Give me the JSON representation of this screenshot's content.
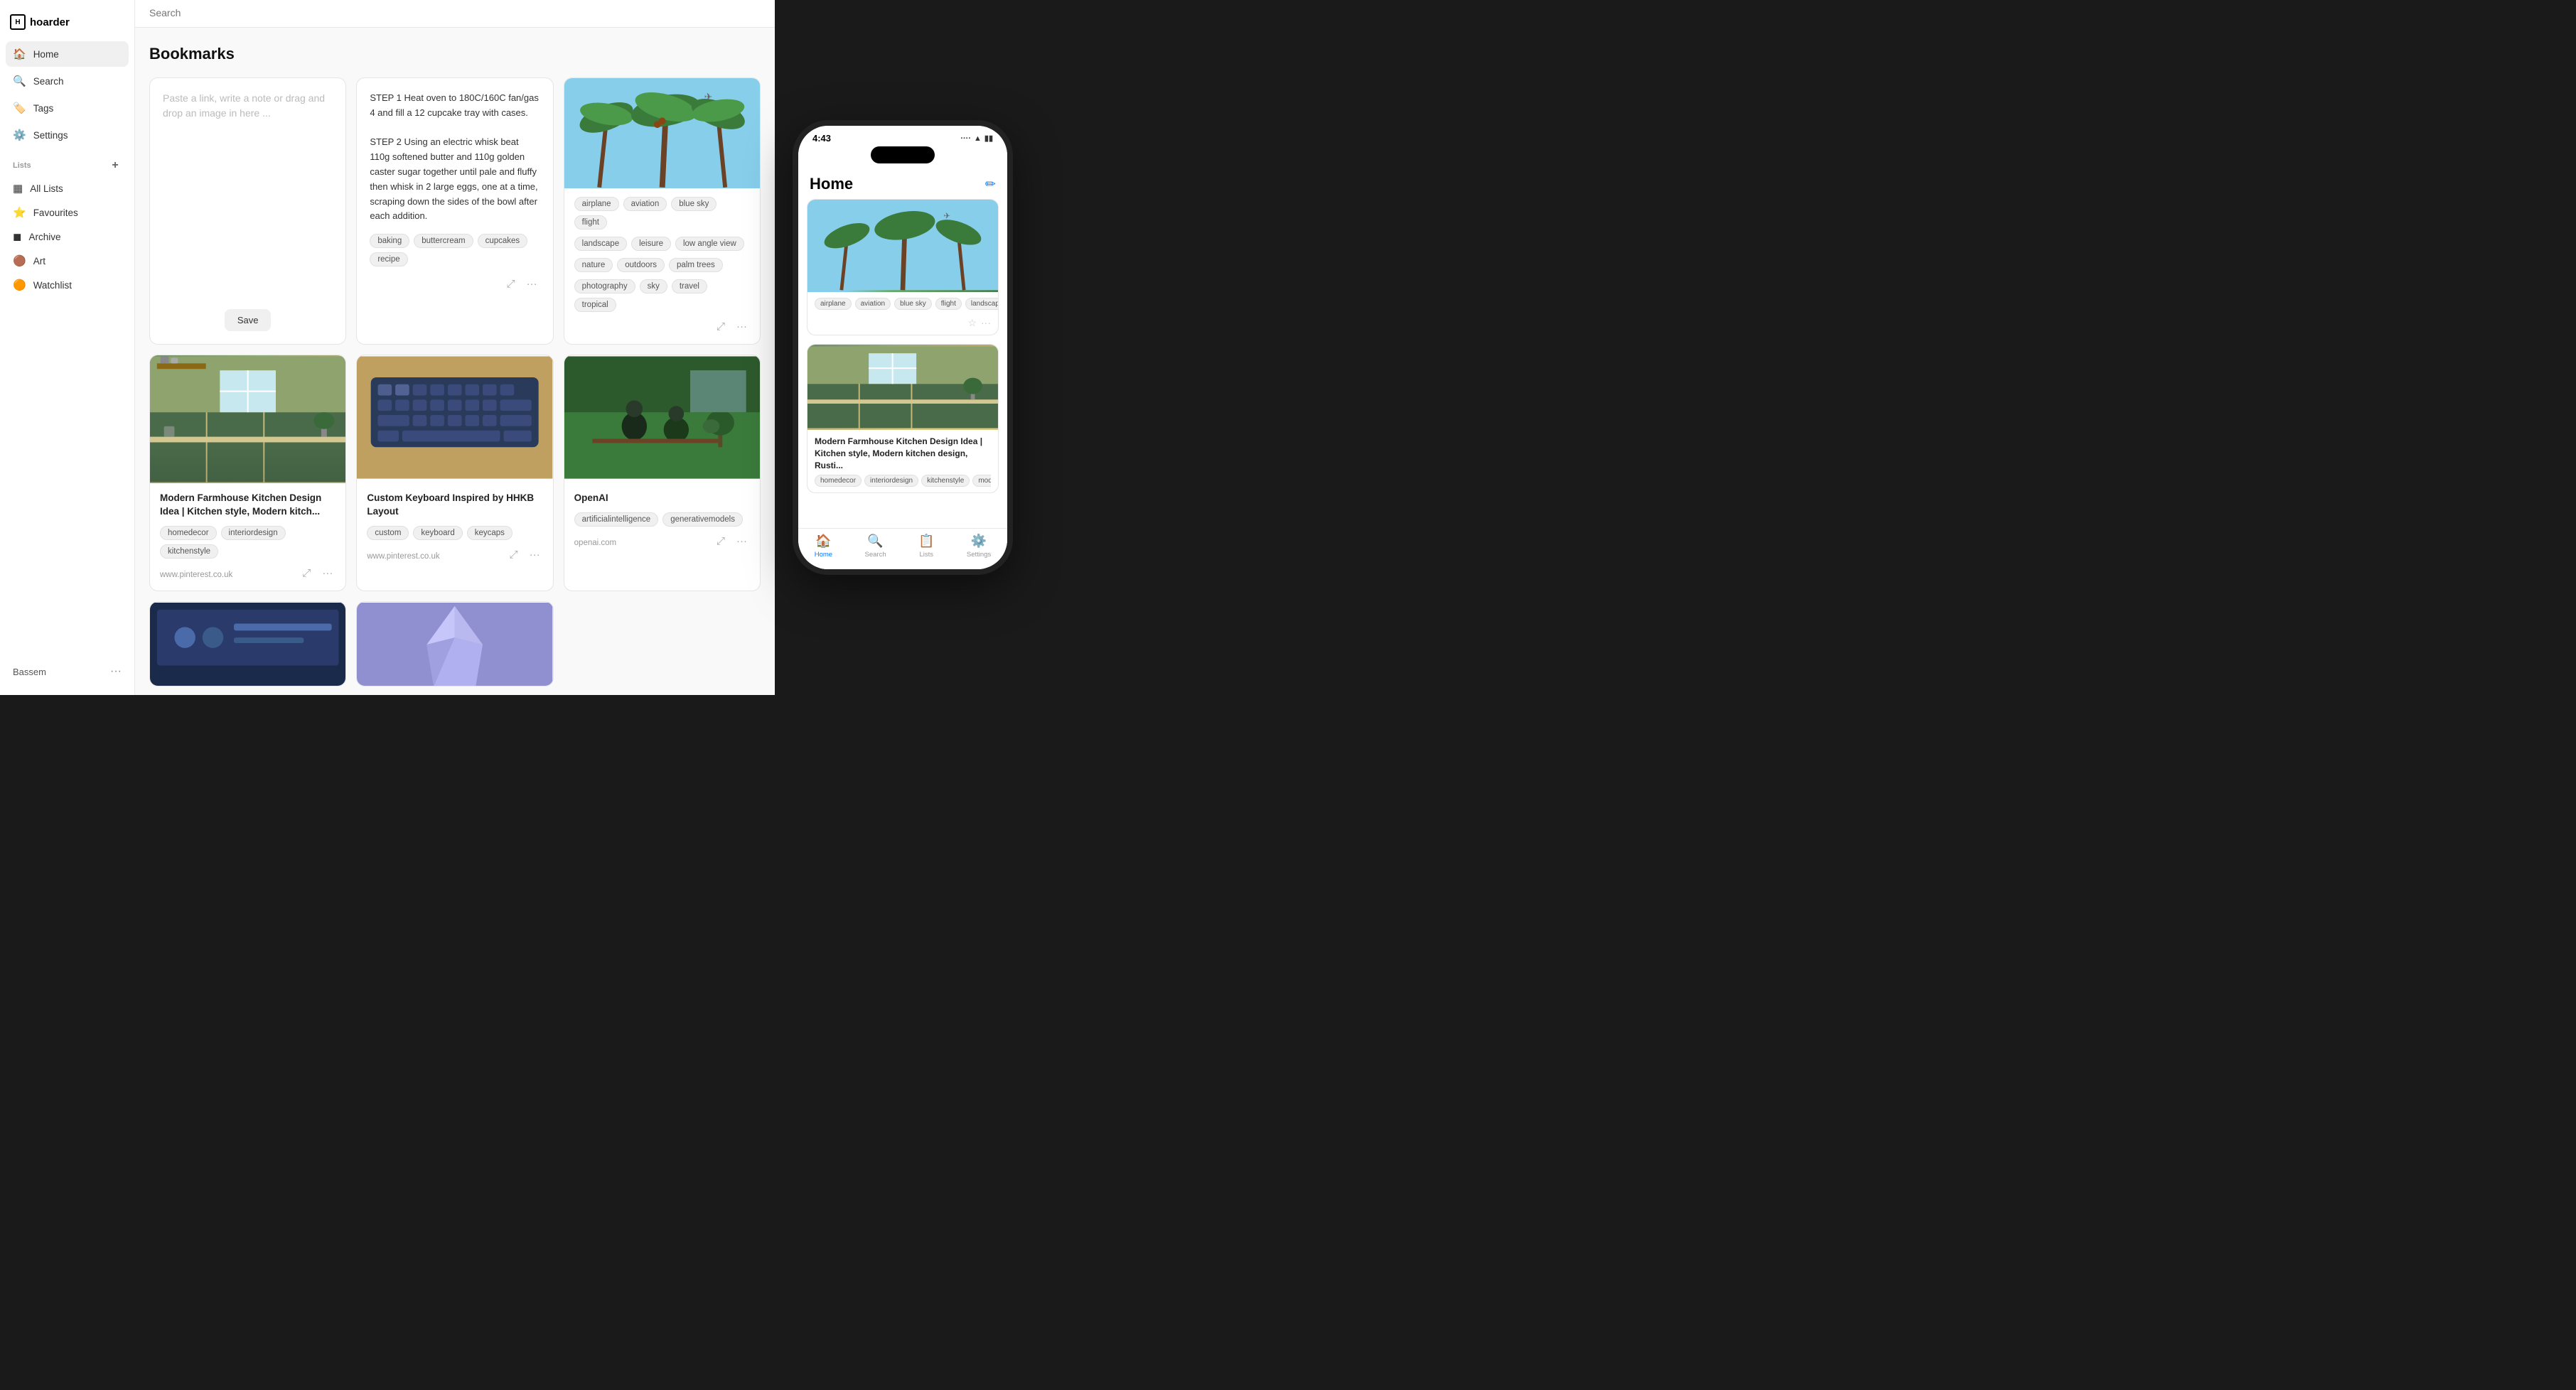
{
  "app": {
    "logo_icon": "H",
    "logo_text": "hoarder"
  },
  "sidebar": {
    "nav_items": [
      {
        "id": "home",
        "label": "Home",
        "icon": "🏠",
        "active": true
      },
      {
        "id": "search",
        "label": "Search",
        "icon": "🔍",
        "active": false
      },
      {
        "id": "tags",
        "label": "Tags",
        "icon": "🏷️",
        "active": false
      },
      {
        "id": "settings",
        "label": "Settings",
        "icon": "⚙️",
        "active": false
      }
    ],
    "lists_title": "Lists",
    "list_items": [
      {
        "id": "all-lists",
        "label": "All Lists",
        "icon": "▦"
      },
      {
        "id": "favourites",
        "label": "Favourites",
        "icon": "⭐"
      },
      {
        "id": "archive",
        "label": "Archive",
        "icon": "◼"
      },
      {
        "id": "art",
        "label": "Art",
        "icon": "🟤"
      },
      {
        "id": "watchlist",
        "label": "Watchlist",
        "icon": "🟠"
      }
    ],
    "footer_user": "Bassem",
    "footer_dots": "···"
  },
  "search": {
    "placeholder": "Search"
  },
  "main": {
    "title": "Bookmarks",
    "new_note_placeholder": "Paste a link, write a note or drag and drop an image in here ...",
    "save_button_label": "Save"
  },
  "cards": [
    {
      "type": "text",
      "body": "STEP 1 Heat oven to 180C/160C fan/gas 4 and fill a 12 cupcake tray with cases.\n\nSTEP 2 Using an electric whisk beat 110g softened butter and 110g golden caster sugar together until pale and fluffy then whisk in 2 large eggs, one at a time, scraping down the sides of the bowl after each addition.",
      "tags": [
        "baking",
        "buttercream",
        "cupcakes",
        "recipe"
      ]
    },
    {
      "type": "image",
      "image_type": "palm",
      "tags": [
        "airplane",
        "aviation",
        "blue sky",
        "flight",
        "landscape",
        "leisure",
        "low angle view",
        "nature",
        "outdoors",
        "palm trees",
        "photography",
        "sky",
        "travel",
        "tropical"
      ]
    },
    {
      "type": "image",
      "image_type": "kitchen",
      "title": "Modern Farmhouse Kitchen Design Idea | Kitchen style, Modern kitch...",
      "tags": [
        "homedecor",
        "interiordesign",
        "kitchenstyle"
      ],
      "url": "www.pinterest.co.uk"
    },
    {
      "type": "image",
      "image_type": "keyboard",
      "title": "Custom Keyboard Inspired by HHKB Layout",
      "tags": [
        "custom",
        "keyboard",
        "keycaps"
      ],
      "url": "www.pinterest.co.uk"
    },
    {
      "type": "image",
      "image_type": "openai",
      "title": "OpenAI",
      "tags": [
        "artificialintelligence",
        "generativemodels"
      ],
      "url": "openai.com"
    },
    {
      "type": "image",
      "image_type": "board",
      "title": "",
      "tags": []
    },
    {
      "type": "image",
      "image_type": "crystal",
      "title": "",
      "tags": []
    }
  ],
  "phone": {
    "time": "4:43",
    "title": "Home",
    "edit_icon": "✏",
    "palm_tags": [
      "airplane",
      "aviation",
      "blue sky",
      "flight",
      "landscape"
    ],
    "kitchen_title": "Modern Farmhouse Kitchen Design Idea | Kitchen style, Modern kitchen design, Rusti...",
    "kitchen_tags": [
      "homedecor",
      "interiordesign",
      "kitchenstyle",
      "modern"
    ],
    "nav_items": [
      {
        "id": "home",
        "label": "Home",
        "icon": "🏠",
        "active": true
      },
      {
        "id": "search",
        "label": "Search",
        "icon": "🔍",
        "active": false
      },
      {
        "id": "lists",
        "label": "Lists",
        "icon": "📋",
        "active": false
      },
      {
        "id": "settings",
        "label": "Settings",
        "icon": "⚙️",
        "active": false
      }
    ]
  }
}
